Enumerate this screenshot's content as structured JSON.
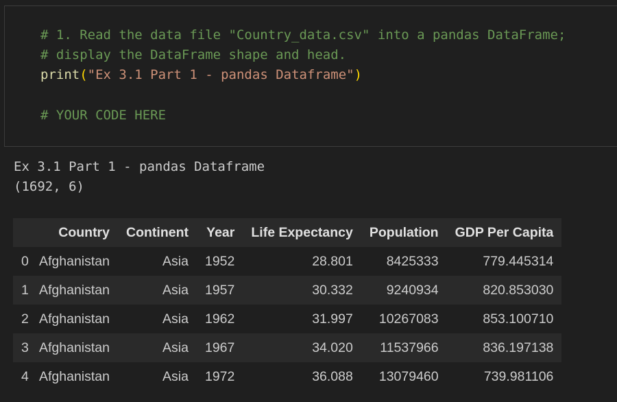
{
  "code_cell": {
    "lines": [
      "# 1. Read the data file \"Country_data.csv\" into a pandas DataFrame;",
      "# display the DataFrame shape and head.",
      "",
      "",
      "# YOUR CODE HERE"
    ],
    "print_fn": "print",
    "print_open": "(",
    "print_arg": "\"Ex 3.1 Part 1 - pandas Dataframe\"",
    "print_close": ")"
  },
  "output": {
    "line1": "Ex 3.1 Part 1 - pandas Dataframe",
    "line2": "(1692, 6)"
  },
  "dataframe": {
    "columns": [
      "",
      "Country",
      "Continent",
      "Year",
      "Life Expectancy",
      "Population",
      "GDP Per Capita"
    ],
    "rows": [
      [
        "0",
        "Afghanistan",
        "Asia",
        "1952",
        "28.801",
        "8425333",
        "779.445314"
      ],
      [
        "1",
        "Afghanistan",
        "Asia",
        "1957",
        "30.332",
        "9240934",
        "820.853030"
      ],
      [
        "2",
        "Afghanistan",
        "Asia",
        "1962",
        "31.997",
        "10267083",
        "853.100710"
      ],
      [
        "3",
        "Afghanistan",
        "Asia",
        "1967",
        "34.020",
        "11537966",
        "836.197138"
      ],
      [
        "4",
        "Afghanistan",
        "Asia",
        "1972",
        "36.088",
        "13079460",
        "739.981106"
      ]
    ]
  }
}
